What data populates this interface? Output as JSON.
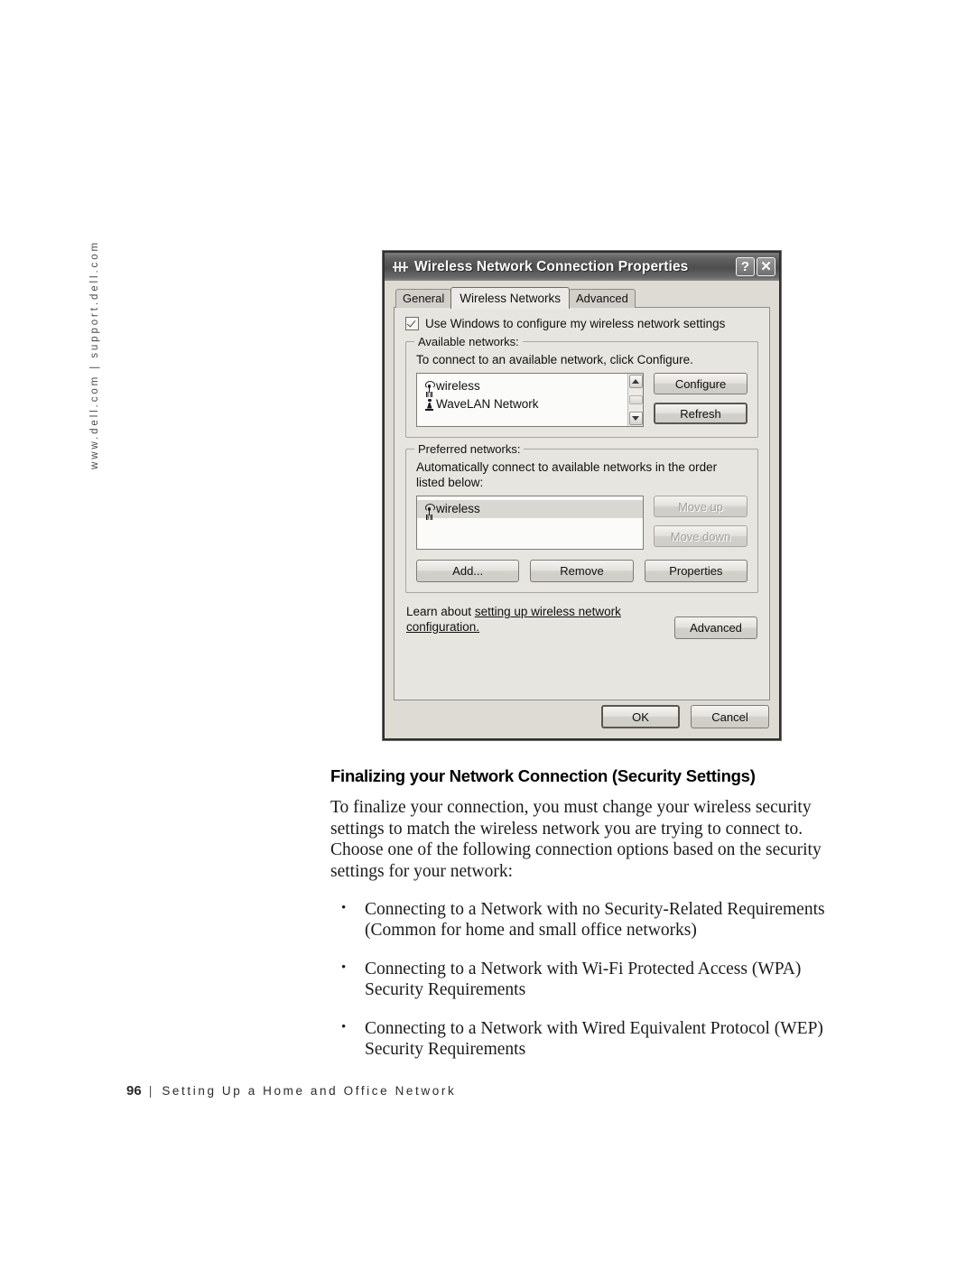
{
  "page": {
    "side_url": "www.dell.com | support.dell.com",
    "footer": {
      "page_number": "96",
      "separator": "|",
      "section": "Setting Up a Home and Office Network"
    }
  },
  "dialog": {
    "title": "Wireless Network Connection Properties",
    "title_icon": "network-connection-icon",
    "help_button": "?",
    "close_button": "✕",
    "tabs": [
      {
        "label": "General",
        "active": false
      },
      {
        "label": "Wireless Networks",
        "active": true
      },
      {
        "label": "Advanced",
        "active": false
      }
    ],
    "use_windows_checkbox": {
      "label": "Use Windows to configure my wireless network settings",
      "checked": true
    },
    "available_networks": {
      "group_title": "Available networks:",
      "description": "To connect to an available network, click Configure.",
      "items": [
        {
          "name": "wireless",
          "icon": "access-point-icon"
        },
        {
          "name": "WaveLAN Network",
          "icon": "ad-hoc-computer-icon"
        }
      ],
      "buttons": [
        {
          "label": "Configure",
          "disabled": false,
          "default": false
        },
        {
          "label": "Refresh",
          "disabled": false,
          "default": true
        }
      ]
    },
    "preferred_networks": {
      "group_title": "Preferred networks:",
      "description": "Automatically connect to available networks in the order listed below:",
      "items": [
        {
          "name": "wireless",
          "icon": "access-point-icon",
          "selected": true
        }
      ],
      "side_buttons": [
        {
          "label": "Move up",
          "disabled": true
        },
        {
          "label": "Move down",
          "disabled": true
        }
      ],
      "bottom_buttons": [
        {
          "label": "Add...",
          "disabled": false
        },
        {
          "label": "Remove",
          "disabled": false
        },
        {
          "label": "Properties",
          "disabled": false
        }
      ]
    },
    "learn_more": {
      "prefix": "Learn about ",
      "link": "setting up wireless network configuration."
    },
    "advanced_button": "Advanced",
    "ok_button": "OK",
    "cancel_button": "Cancel"
  },
  "article": {
    "heading": "Finalizing your Network Connection (Security Settings)",
    "paragraph": "To finalize your connection, you must change your wireless security settings to match the wireless network you are trying to connect to. Choose one of the following connection options based on the security settings for your network:",
    "bullets": [
      "Connecting to a Network with no Security-Related Requirements (Common for home and small office networks)",
      "Connecting to a Network with Wi-Fi Protected Access (WPA) Security Requirements",
      "Connecting to a Network with Wired Equivalent Protocol (WEP) Security Requirements"
    ]
  }
}
